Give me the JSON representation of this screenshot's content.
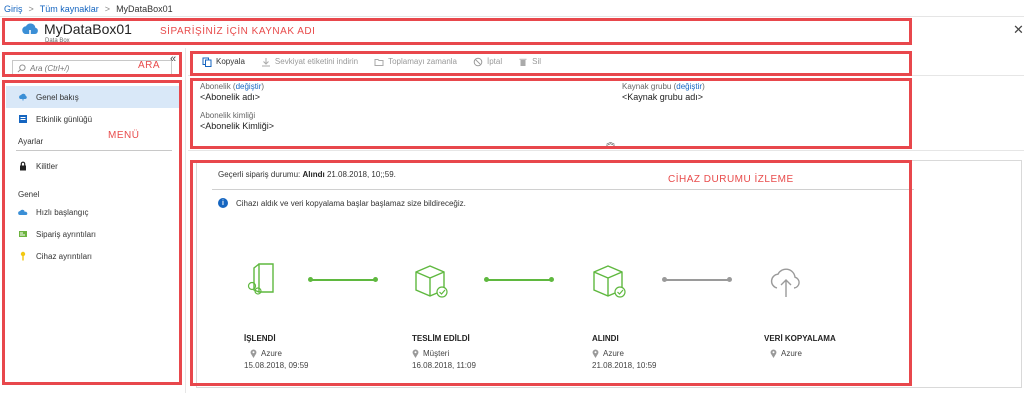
{
  "breadcrumb": {
    "home": "Giriş",
    "resources": "Tüm kaynaklar",
    "current": "MyDataBox01"
  },
  "header": {
    "title": "MyDataBox01",
    "subtitle": "Data Box",
    "annotation": "SİPARİŞİNİZ İÇİN KAYNAK ADI",
    "icon": "databox-cloud-icon",
    "close_icon": "close-icon"
  },
  "sidebar": {
    "search_placeholder": "Ara (Ctrl+/)",
    "search_annotation": "ARA",
    "menu_annotation": "MENÜ",
    "items": [
      {
        "label": "Genel bakış",
        "icon": "overview-cloud-icon",
        "active": true
      },
      {
        "label": "Etkinlik günlüğü",
        "icon": "activity-log-icon"
      }
    ],
    "sections": [
      {
        "title": "Ayarlar",
        "items": [
          {
            "label": "Kilitler",
            "icon": "lock-icon"
          }
        ]
      },
      {
        "title": "Genel",
        "items": [
          {
            "label": "Hızlı başlangıç",
            "icon": "quickstart-cloud-icon"
          },
          {
            "label": "Sipariş ayrıntıları",
            "icon": "order-details-icon"
          },
          {
            "label": "Cihaz ayrıntıları",
            "icon": "key-icon"
          }
        ]
      }
    ]
  },
  "toolbar": {
    "copy": "Kopyala",
    "download_label": "Sevkiyat etiketini indirin",
    "schedule_pickup": "Toplamayı zamanla",
    "cancel": "İptal",
    "delete": "Sil"
  },
  "essentials": {
    "subscription_label": "Abonelik",
    "change_link": "değiştir",
    "subscription_value": "<Abonelik adı>",
    "subscription_id_label": "Abonelik kimliği",
    "subscription_id_value": "<Abonelik Kimliği>",
    "resource_group_label": "Kaynak grubu",
    "resource_group_value": "<Kaynak grubu adı>"
  },
  "status": {
    "annotation": "CİHAZ DURUMU İZLEME",
    "current_label": "Geçerli sipariş durumu:",
    "current_value": "Alındı",
    "current_time": "21.08.2018, 10;;59.",
    "info": "Cihazı aldık ve veri kopyalama başlar başlamaz size bildireceğiz.",
    "accent_color": "#5fb83f",
    "pending_color": "#9a9a9a",
    "steps": [
      {
        "name": "İŞLENDİ",
        "location": "Azure",
        "date": "15.08.2018, 09:59"
      },
      {
        "name": "TESLİM EDİLDİ",
        "location": "Müşteri",
        "date": "16.08.2018, 11:09"
      },
      {
        "name": "ALINDI",
        "location": "Azure",
        "date": "21.08.2018, 10:59"
      },
      {
        "name": "VERİ KOPYALAMA",
        "location": "Azure",
        "date": ""
      }
    ]
  }
}
